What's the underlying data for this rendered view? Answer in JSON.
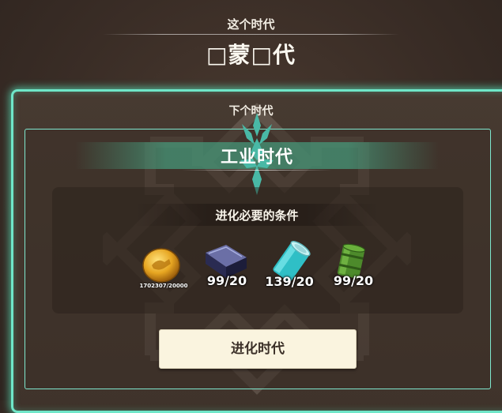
{
  "current_era": {
    "label": "这个时代",
    "name": "□蒙□代"
  },
  "next_era": {
    "label": "下个时代",
    "name": "工业时代"
  },
  "requirements": {
    "title": "进化必要的条件",
    "items": [
      {
        "icon": "gold-coin-icon",
        "count": "1702307/20000"
      },
      {
        "icon": "iron-ingot-icon",
        "count": "99/20"
      },
      {
        "icon": "glass-canister-icon",
        "count": "139/20"
      },
      {
        "icon": "oil-barrel-icon",
        "count": "99/20"
      }
    ]
  },
  "evolve_button": {
    "label": "进化时代"
  },
  "colors": {
    "accent_glow": "#6fe6c8",
    "button_bg": "#faf4df",
    "background": "#3a2d26"
  }
}
